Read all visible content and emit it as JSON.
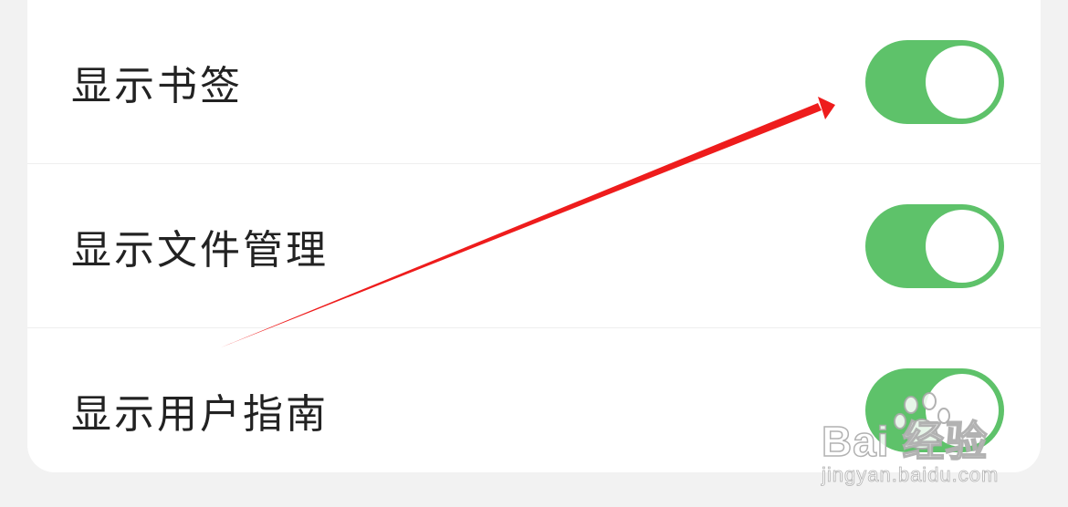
{
  "settings": {
    "items": [
      {
        "label": "显示书签",
        "enabled": true
      },
      {
        "label": "显示文件管理",
        "enabled": true
      },
      {
        "label": "显示用户指南",
        "enabled": true
      }
    ]
  },
  "colors": {
    "toggle_on": "#5ec26a",
    "knob": "#ffffff",
    "arrow": "#ee1c1c",
    "card": "#ffffff",
    "page_bg": "#f2f2f2"
  },
  "annotation": {
    "icon": "red-arrow-icon"
  },
  "watermark": {
    "brand": "Bai  经验",
    "domain": "jingyan.baidu.com"
  }
}
